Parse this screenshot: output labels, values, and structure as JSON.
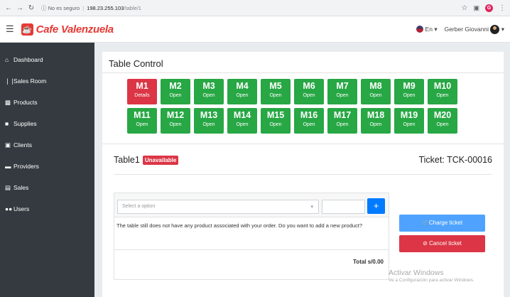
{
  "browser": {
    "back_icon": "arrow-left-icon",
    "forward_icon": "arrow-right-icon",
    "reload_icon": "reload-icon",
    "security_label": "No es seguro",
    "host": "198.23.255.103",
    "path": "/table/1"
  },
  "header": {
    "brand": "Cafe Valenzuela",
    "language": "En",
    "user_name": "Gerber Giovanni"
  },
  "sidebar": {
    "items": [
      {
        "label": "Dashboard",
        "icon": "home-icon"
      },
      {
        "label": "Sales Room",
        "icon": "utensils-icon"
      },
      {
        "label": "Products",
        "icon": "id-card-icon"
      },
      {
        "label": "Supplies",
        "icon": "box-icon"
      },
      {
        "label": "Clients",
        "icon": "address-book-icon"
      },
      {
        "label": "Providers",
        "icon": "truck-icon"
      },
      {
        "label": "Sales",
        "icon": "file-icon"
      },
      {
        "label": "Users",
        "icon": "users-icon"
      }
    ]
  },
  "page": {
    "title": "Table Control"
  },
  "tables": [
    {
      "name": "M1",
      "status": "Details",
      "state": "busy"
    },
    {
      "name": "M2",
      "status": "Open",
      "state": "open"
    },
    {
      "name": "M3",
      "status": "Open",
      "state": "open"
    },
    {
      "name": "M4",
      "status": "Open",
      "state": "open"
    },
    {
      "name": "M5",
      "status": "Open",
      "state": "open"
    },
    {
      "name": "M6",
      "status": "Open",
      "state": "open"
    },
    {
      "name": "M7",
      "status": "Open",
      "state": "open"
    },
    {
      "name": "M8",
      "status": "Open",
      "state": "open"
    },
    {
      "name": "M9",
      "status": "Open",
      "state": "open"
    },
    {
      "name": "M10",
      "status": "Open",
      "state": "open"
    },
    {
      "name": "M11",
      "status": "Open",
      "state": "open"
    },
    {
      "name": "M12",
      "status": "Open",
      "state": "open"
    },
    {
      "name": "M13",
      "status": "Open",
      "state": "open"
    },
    {
      "name": "M14",
      "status": "Open",
      "state": "open"
    },
    {
      "name": "M15",
      "status": "Open",
      "state": "open"
    },
    {
      "name": "M16",
      "status": "Open",
      "state": "open"
    },
    {
      "name": "M17",
      "status": "Open",
      "state": "open"
    },
    {
      "name": "M18",
      "status": "Open",
      "state": "open"
    },
    {
      "name": "M19",
      "status": "Open",
      "state": "open"
    },
    {
      "name": "M20",
      "status": "Open",
      "state": "open"
    }
  ],
  "order": {
    "table_name": "Table1",
    "status_badge": "Unavailable",
    "ticket": "Ticket: TCK-00016",
    "select_placeholder": "Select a option",
    "quantity_value": "",
    "add_label": "+",
    "message": "The table still does not have any product associated with your order. Do you want to add a new product?",
    "total": "Total s/0.00",
    "charge_label": "Charge ticket",
    "cancel_label": "Cancel ticket"
  },
  "watermark": {
    "line1": "Activar Windows",
    "line2": "Ve a Configuración para activar Windows."
  },
  "colors": {
    "brand": "#e53935",
    "open": "#28a745",
    "busy": "#dc3545",
    "primary": "#007bff",
    "sidebar": "#343a40"
  }
}
